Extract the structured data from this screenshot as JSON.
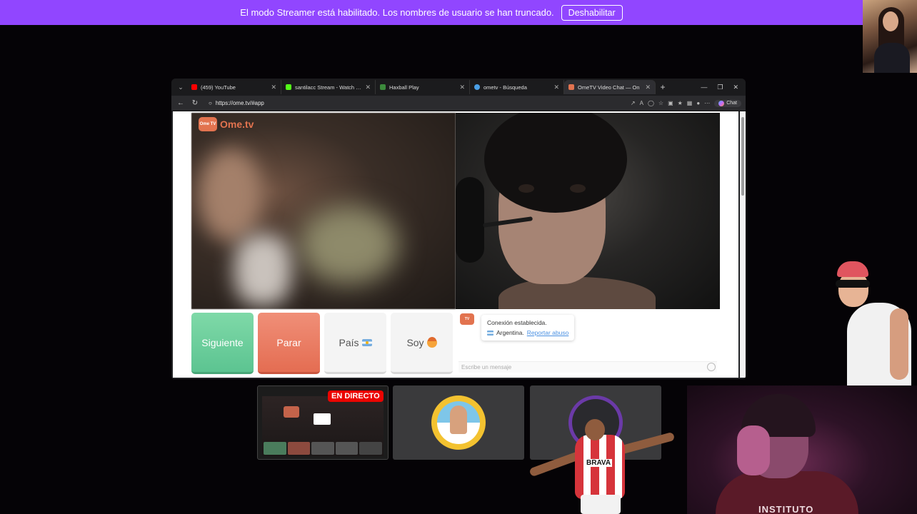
{
  "banner": {
    "message": "El modo Streamer está habilitado. Los nombres de usuario se han truncado.",
    "button_label": "Deshabilitar",
    "color": "#9146ff"
  },
  "browser": {
    "tabs": [
      {
        "title": "(459) YouTube",
        "icon": "youtube-icon",
        "favicon_color": "#ff0000"
      },
      {
        "title": "santilacc Stream - Watch Live o",
        "icon": "kick-icon",
        "favicon_color": "#53fc18"
      },
      {
        "title": "Haxball Play",
        "icon": "haxball-icon",
        "favicon_color": "#3c8a3c"
      },
      {
        "title": "ometv - Búsqueda",
        "icon": "search-icon",
        "favicon_color": "#4a9fe6"
      },
      {
        "title": "OmeTV Video Chat — On",
        "icon": "ometv-icon",
        "favicon_color": "#e2734f"
      }
    ],
    "new_tab": "+",
    "url": "https://ome.tv/#app",
    "copilot_label": "Chat"
  },
  "ometv": {
    "logo_badge": "Ome TV",
    "logo_text": "Ome.tv",
    "buttons": {
      "next": "Siguiente",
      "stop": "Parar",
      "country": "País",
      "gender": "Soy"
    },
    "chat": {
      "status": "Conexión establecida.",
      "country": "Argentina.",
      "report_link": "Reportar abuso",
      "input_placeholder": "Escribe un mensaje"
    }
  },
  "overlay": {
    "live_badge": "EN DIRECTO",
    "player_sponsor": "BRAVA",
    "shirt_text": "INSTITUTO"
  },
  "colors": {
    "next": "#5cc491",
    "stop": "#e46d52",
    "brand": "#e2734f",
    "live": "#eb0400"
  }
}
